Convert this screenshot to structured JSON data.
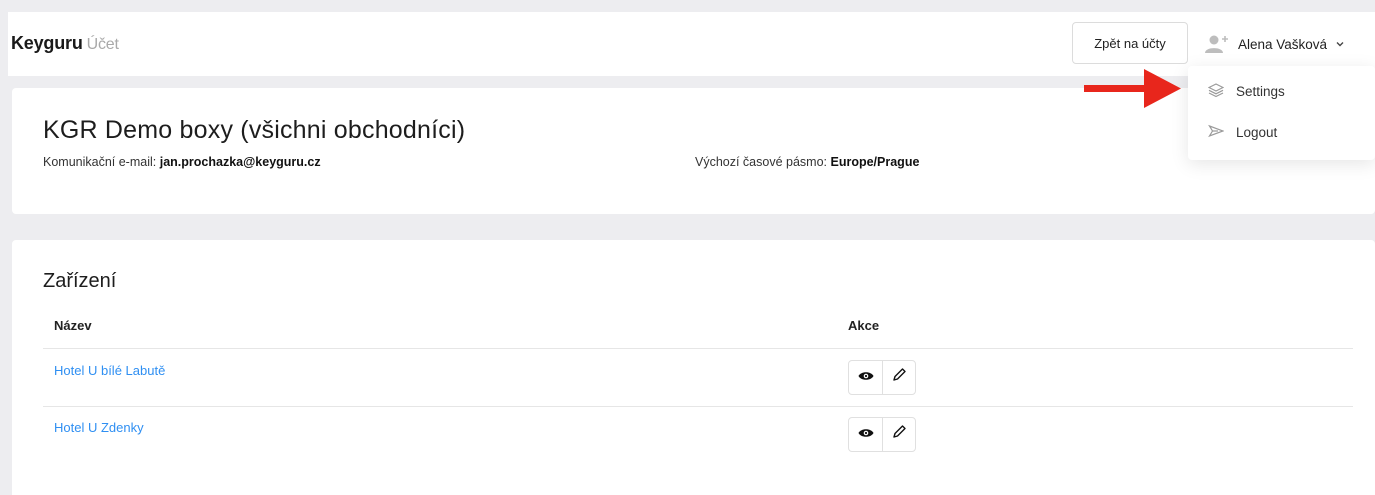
{
  "header": {
    "brand": "Keyguru",
    "section": "Účet",
    "back_button": "Zpět na účty",
    "user_name": "Alena Vašková"
  },
  "user_dropdown": {
    "items": [
      {
        "label": "Settings",
        "icon": "layers-icon"
      },
      {
        "label": "Logout",
        "icon": "send-icon"
      }
    ]
  },
  "annotation": {
    "color": "#e8261c"
  },
  "account": {
    "title": "KGR Demo boxy (všichni obchodníci)",
    "email_label": "Komunikační e-mail:",
    "email_value": "jan.prochazka@keyguru.cz",
    "timezone_label": "Výchozí časové pásmo:",
    "timezone_value": "Europe/Prague"
  },
  "devices": {
    "title": "Zařízení",
    "columns": [
      "Název",
      "Akce"
    ],
    "rows": [
      {
        "name": "Hotel U bílé Labutě"
      },
      {
        "name": "Hotel U Zdenky"
      }
    ]
  },
  "colors": {
    "link": "#2f8ff2",
    "page_bg": "#ededf0"
  }
}
